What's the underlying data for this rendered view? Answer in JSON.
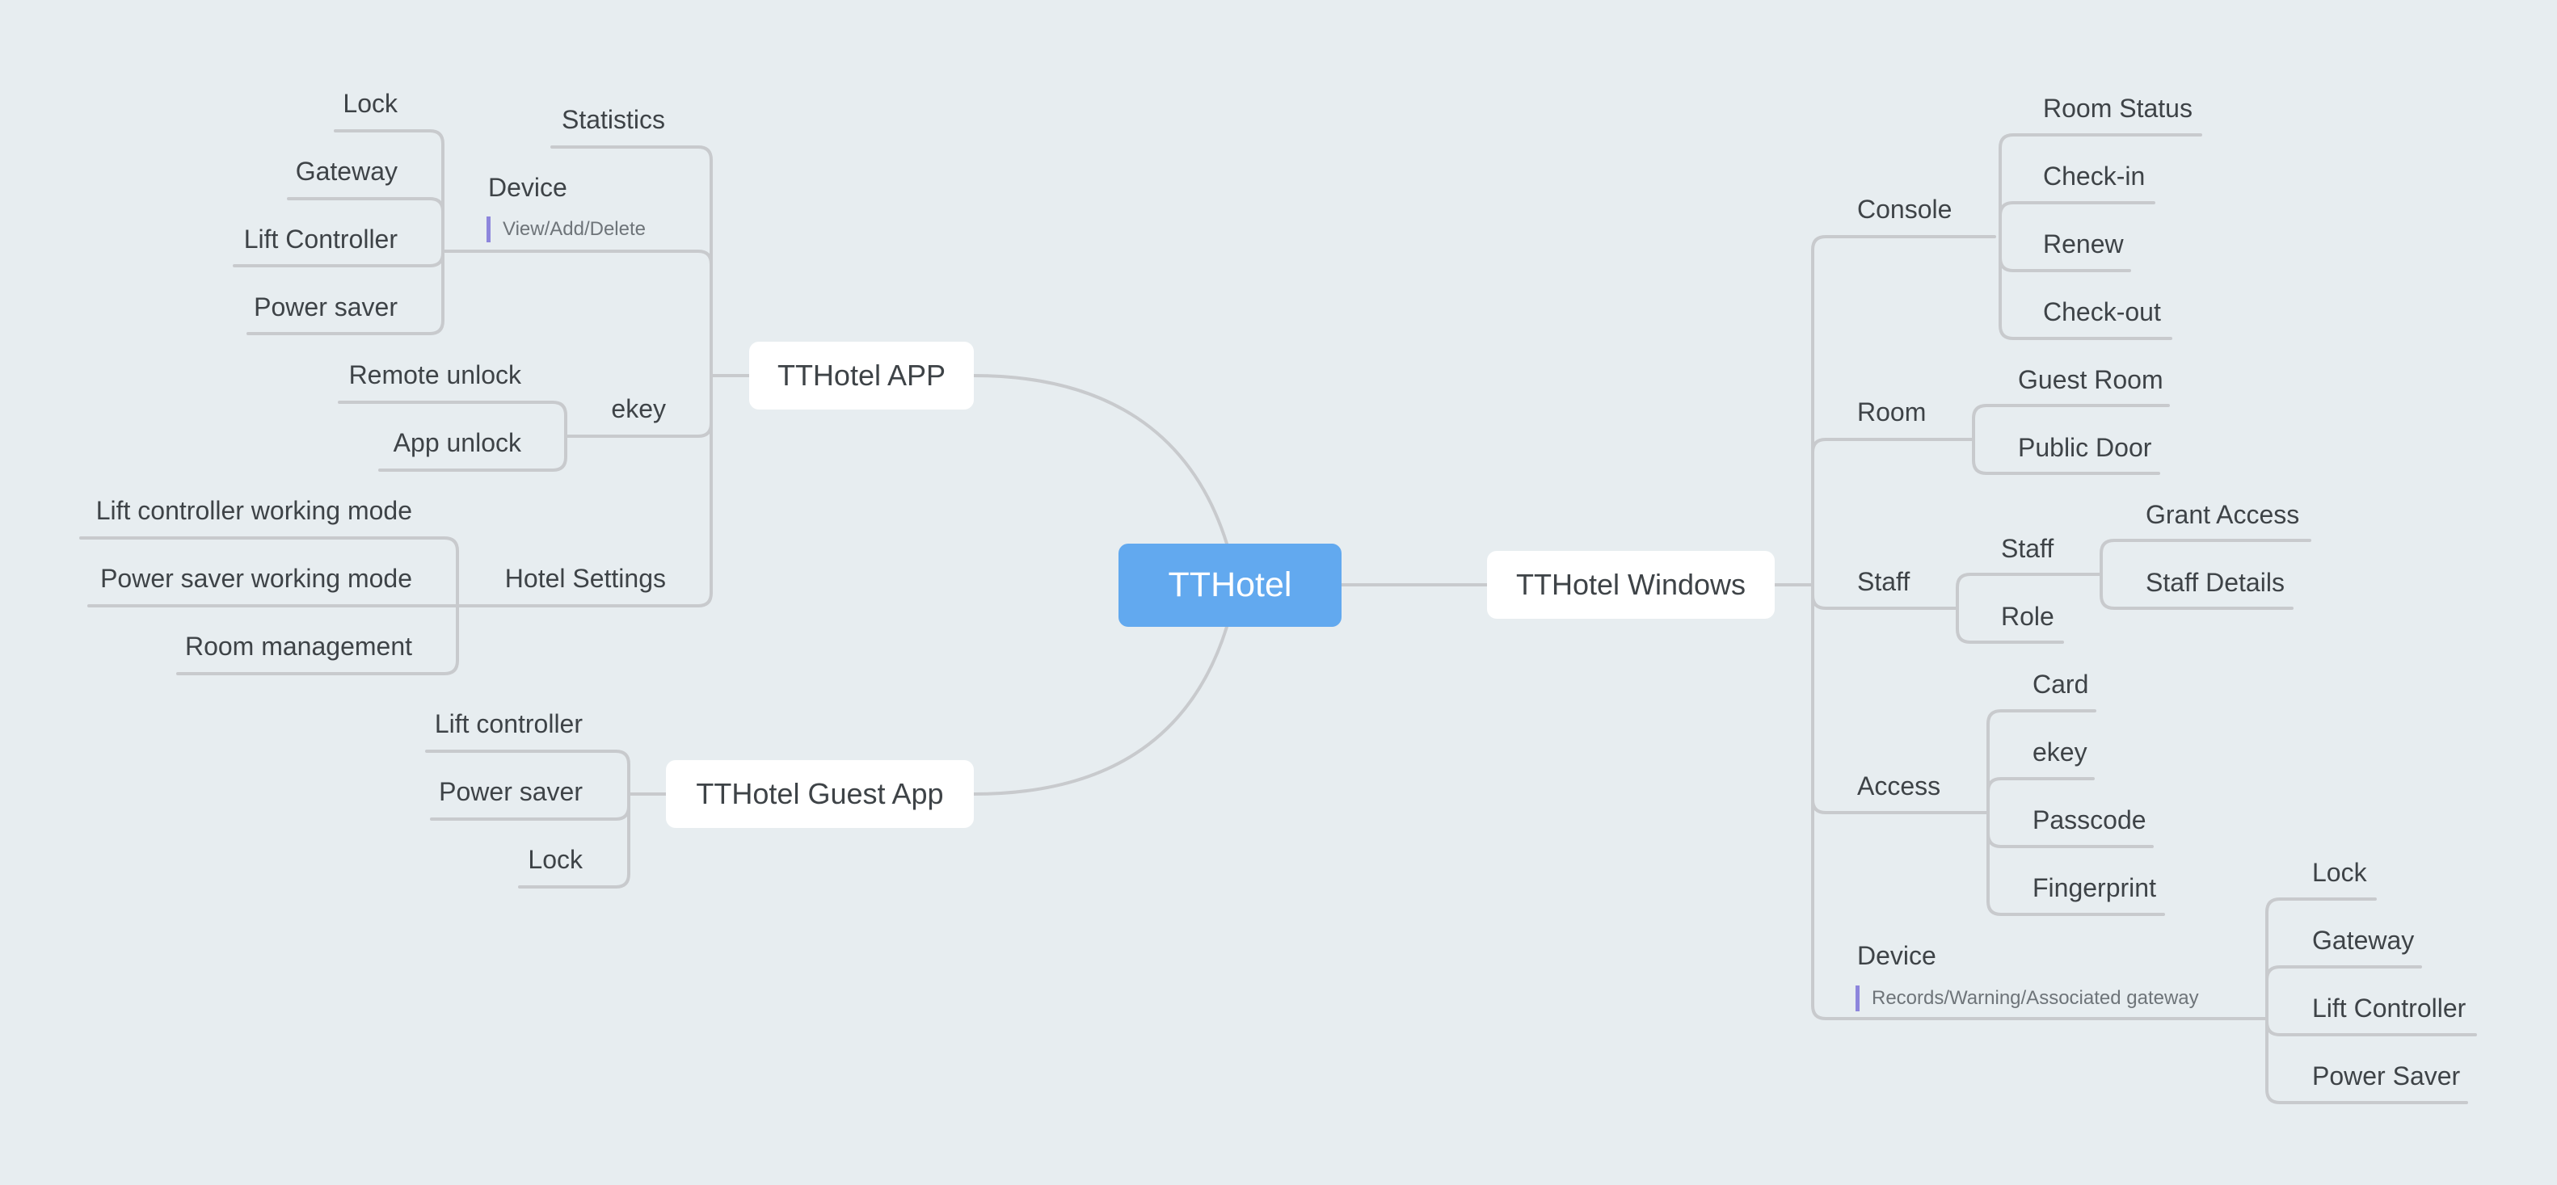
{
  "mindmap": {
    "root": {
      "label": "TTHotel",
      "color": "#62a9ef"
    },
    "line_color": "#c8cacd",
    "background": "#e7edf0",
    "note_marker_color": "#8d86dc",
    "branches": {
      "app": {
        "label": "TTHotel APP",
        "children": {
          "statistics": {
            "label": "Statistics"
          },
          "device": {
            "label": "Device",
            "note": "View/Add/Delete",
            "children": [
              "Lock",
              "Gateway",
              "Lift Controller",
              "Power saver"
            ]
          },
          "ekey": {
            "label": "ekey",
            "children": [
              "Remote unlock",
              "App unlock"
            ]
          },
          "hotel_settings": {
            "label": "Hotel Settings",
            "children": [
              "Lift controller working mode",
              "Power saver working mode",
              "Room management"
            ]
          }
        }
      },
      "guest_app": {
        "label": "TTHotel Guest App",
        "children": [
          "Lift controller",
          "Power saver",
          "Lock"
        ]
      },
      "windows": {
        "label": "TTHotel Windows",
        "children": {
          "console": {
            "label": "Console",
            "children": [
              "Room Status",
              "Check-in",
              "Renew",
              "Check-out"
            ]
          },
          "room": {
            "label": "Room",
            "children": [
              "Guest Room",
              "Public Door"
            ]
          },
          "staff": {
            "label": "Staff",
            "children": {
              "staff": {
                "label": "Staff",
                "children": [
                  "Grant Access",
                  "Staff Details"
                ]
              },
              "role": {
                "label": "Role"
              }
            }
          },
          "access": {
            "label": "Access",
            "children": [
              "Card",
              "ekey",
              "Passcode",
              "Fingerprint"
            ]
          },
          "device": {
            "label": "Device",
            "note": "Records/Warning/Associated gateway",
            "children": [
              "Lock",
              "Gateway",
              "Lift Controller",
              "Power Saver"
            ]
          }
        }
      }
    }
  }
}
